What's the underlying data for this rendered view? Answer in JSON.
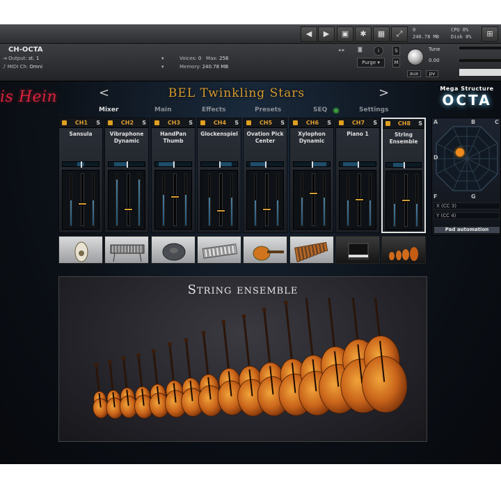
{
  "host": {
    "voices_label": "Voices:",
    "voices_value": "0",
    "max_label": "Max:",
    "max_value": "256",
    "memory_label": "Memory:",
    "memory_value": "240.78 MB",
    "top_memory": "0",
    "top_memory2": "240.78 MB",
    "cpu_label": "CPU",
    "cpu_value": "0%",
    "disk_label": "Disk",
    "disk_value": "0%"
  },
  "instrument": {
    "name": "CH-OCTA",
    "output_label": "Output:",
    "output_value": "st. 1",
    "midi_label": "MIDI Ch:",
    "midi_value": "Omni",
    "purge_label": "Purge",
    "tune_label": "Tune",
    "tune_value": "0.00",
    "solo": "S",
    "mute": "M",
    "aux": "aux",
    "pv": "pv",
    "info": "i"
  },
  "plugin": {
    "brand": "is Hein",
    "title": "BEL Twinkling Stars",
    "prev_arrow": "<",
    "next_arrow": ">",
    "logo_line1": "Mega Structure",
    "logo_line2": "OCTA"
  },
  "tabs": [
    {
      "label": "Mixer",
      "active": true
    },
    {
      "label": "Main",
      "active": false
    },
    {
      "label": "Effects",
      "active": false
    },
    {
      "label": "Presets",
      "active": false
    },
    {
      "label": "SEQ",
      "active": false
    },
    {
      "label": "Settings",
      "active": false
    }
  ],
  "channels": [
    {
      "label": "CH1",
      "solo": "S",
      "instrument": "Sansula",
      "meter": 0.5,
      "fader": 0.42,
      "pan_left": 0.4,
      "pan_right": 0.6
    },
    {
      "label": "CH2",
      "solo": "S",
      "instrument": "Vibraphone Dynamic",
      "meter": 0.9,
      "fader": 0.3,
      "pan_left": 0.15,
      "pan_right": 0.5
    },
    {
      "label": "CH3",
      "solo": "S",
      "instrument": "HandPan Thumb",
      "meter": 0.6,
      "fader": 0.55,
      "pan_left": 0.1,
      "pan_right": 0.5
    },
    {
      "label": "CH4",
      "solo": "S",
      "instrument": "Glockenspiel",
      "meter": 0.55,
      "fader": 0.28,
      "pan_left": 0.5,
      "pan_right": 0.85
    },
    {
      "label": "CH5",
      "solo": "S",
      "instrument": "Ovation Pick Center",
      "meter": 0.5,
      "fader": 0.3,
      "pan_left": 0.1,
      "pan_right": 0.5
    },
    {
      "label": "CH6",
      "solo": "S",
      "instrument": "Xylophon Dynamic",
      "meter": 0.55,
      "fader": 0.62,
      "pan_left": 0.5,
      "pan_right": 0.9
    },
    {
      "label": "CH7",
      "solo": "S",
      "instrument": "Piano 1",
      "meter": 0.5,
      "fader": 0.5,
      "pan_left": 0.1,
      "pan_right": 0.5
    },
    {
      "label": "CH8",
      "solo": "S",
      "instrument": "String Ensemble",
      "meter": 0.45,
      "fader": 0.5,
      "pan_left": 0.2,
      "pan_right": 0.5
    }
  ],
  "pad": {
    "corners": {
      "a": "A",
      "b": "B",
      "c": "C",
      "d": "D",
      "f": "F",
      "g": "G"
    },
    "x_cc": "X (CC 3)",
    "y_cc": "Y (CC 4)",
    "automation": "Pad automation"
  },
  "ensemble": {
    "title": "String ensemble"
  },
  "colors": {
    "accent": "#d79b2c",
    "brand_red": "#d7233b",
    "pad_dot": "#f08a1c"
  }
}
